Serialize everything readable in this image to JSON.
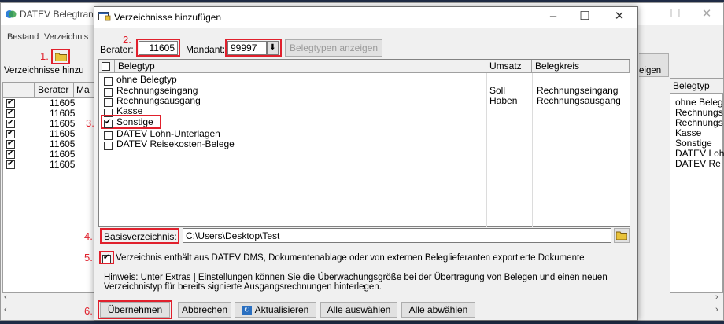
{
  "background_app": {
    "title": "DATEV Belegtrans",
    "menu": [
      "Bestand",
      "Verzeichnis"
    ],
    "toolbar_button_label": "Verzeichnisse hinzu",
    "right_button_label": "eigen",
    "grid_headers": {
      "check": "",
      "berater": "Berater",
      "mandant": "Ma"
    },
    "rows": [
      {
        "checked": true,
        "berater": "11605"
      },
      {
        "checked": true,
        "berater": "11605"
      },
      {
        "checked": true,
        "berater": "11605"
      },
      {
        "checked": true,
        "berater": "11605"
      },
      {
        "checked": true,
        "berater": "11605"
      },
      {
        "checked": true,
        "berater": "11605"
      },
      {
        "checked": true,
        "berater": "11605"
      }
    ],
    "right_grid": {
      "header": "Belegtyp",
      "items": [
        "ohne Beleg",
        "Rechnungs",
        "Rechnungs",
        "Kasse",
        "Sonstige",
        "DATEV Loh",
        "DATEV Re"
      ]
    }
  },
  "annotations": [
    "1.",
    "2.",
    "3.",
    "4.",
    "5.",
    "6."
  ],
  "dialog": {
    "title": "Verzeichnisse hinzufügen",
    "berater_label": "Berater:",
    "berater_value": "11605",
    "mandant_label": "Mandant:",
    "mandant_value": "99997",
    "belegtypen_button": "Belegtypen anzeigen",
    "columns": {
      "belegtyp": "Belegtyp",
      "umsatz": "Umsatz",
      "belegkreis": "Belegkreis"
    },
    "rows": [
      {
        "name": "ohne Belegtyp",
        "checked": false,
        "umsatz": "",
        "belegkreis": ""
      },
      {
        "name": "Rechnungseingang",
        "checked": false,
        "umsatz": "Soll",
        "belegkreis": "Rechnungseingang"
      },
      {
        "name": "Rechnungsausgang",
        "checked": false,
        "umsatz": "Haben",
        "belegkreis": "Rechnungsausgang"
      },
      {
        "name": "Kasse",
        "checked": false,
        "umsatz": "",
        "belegkreis": ""
      },
      {
        "name": "Sonstige",
        "checked": true,
        "umsatz": "",
        "belegkreis": ""
      },
      {
        "name": "DATEV Lohn-Unterlagen",
        "checked": false,
        "umsatz": "",
        "belegkreis": ""
      },
      {
        "name": "DATEV Reisekosten-Belege",
        "checked": false,
        "umsatz": "",
        "belegkreis": ""
      }
    ],
    "basis_label": "Basisverzeichnis:",
    "basis_value": "C:\\Users\\Desktop\\Test",
    "dms_checkbox_checked": true,
    "dms_checkbox_label": "Verzeichnis enthält aus DATEV DMS, Dokumentenablage oder von externen Beleglieferanten exportierte Dokumente",
    "hint": "Hinweis: Unter Extras | Einstellungen können Sie die Überwachungsgröße bei der Übertragung von Belegen und einen neuen Verzeichnistyp für bereits signierte Ausgangsrechnungen hinterlegen.",
    "buttons": {
      "apply": "Übernehmen",
      "cancel": "Abbrechen",
      "refresh": "Aktualisieren",
      "select_all": "Alle auswählen",
      "deselect_all": "Alle abwählen"
    }
  },
  "colors": {
    "annotation_red": "#e0202c",
    "folder_yellow": "#e8c23a"
  }
}
